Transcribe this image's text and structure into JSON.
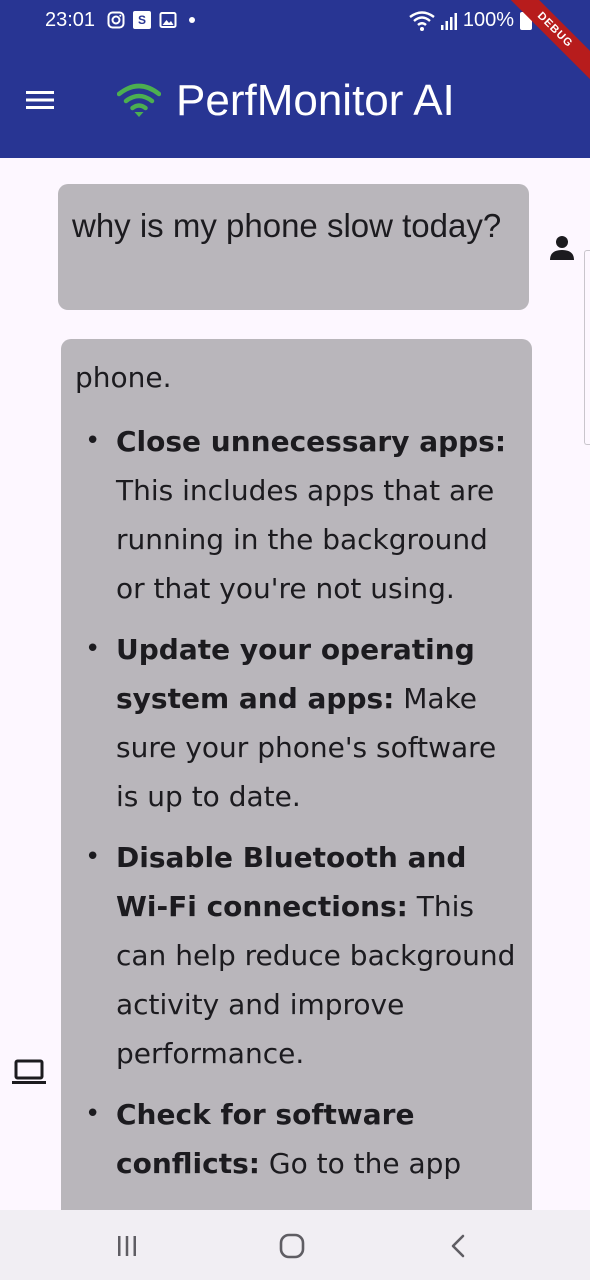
{
  "status_bar": {
    "time": "23:01",
    "battery_text": "100%",
    "notification_icons": [
      "instagram-icon",
      "s-app-icon",
      "gallery-icon",
      "dot-icon"
    ],
    "s_label": "S"
  },
  "debug_banner": "DEBUG",
  "app_bar": {
    "title": "PerfMonitor AI",
    "logo_color": "#4caf50",
    "background_color": "#283593"
  },
  "chat": {
    "user_message": "why is my phone slow today?",
    "bot_message": {
      "intro": "phone.",
      "items": [
        {
          "bold": "Close unnecessary apps:",
          "text": " This includes apps that are running in the background or that you're not using."
        },
        {
          "bold": "Update your operating system and apps:",
          "text": " Make sure your phone's software is up to date."
        },
        {
          "bold": "Disable Bluetooth and Wi-Fi connections:",
          "text": " This can help reduce background activity and improve performance."
        },
        {
          "bold": "Check for software conflicts:",
          "text": " Go to the app"
        }
      ]
    },
    "bubble_color": "#b9b6bb"
  },
  "nav_bar": {
    "buttons": [
      "recents-icon",
      "home-icon",
      "back-icon"
    ]
  }
}
